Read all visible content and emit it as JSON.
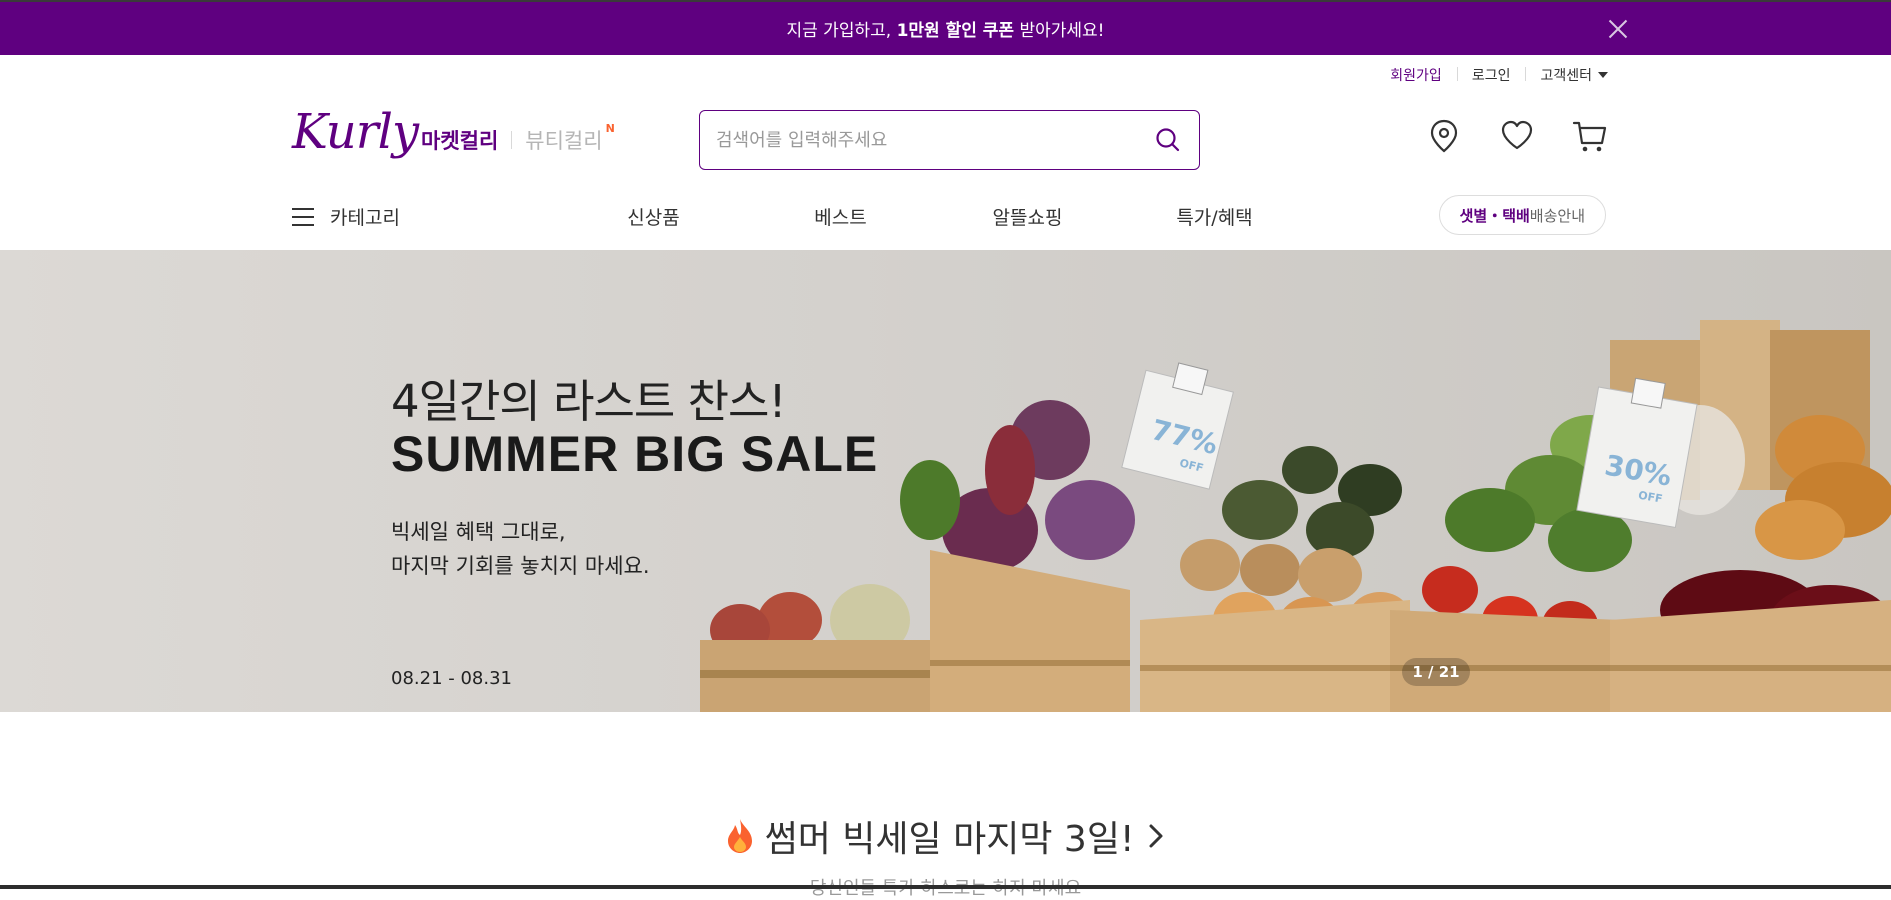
{
  "promo": {
    "text_before": "지금 가입하고, ",
    "text_bold": "1만원 할인 쿠폰",
    "text_after": " 받아가세요!"
  },
  "user_menu": {
    "signup": "회원가입",
    "login": "로그인",
    "customer_center": "고객센터"
  },
  "header": {
    "logo": "Kurly",
    "market_tab": "마켓컬리",
    "beauty_tab": "뷰티컬리",
    "new_badge": "N",
    "search_placeholder": "검색어를 입력해주세요"
  },
  "nav": {
    "category": "카테고리",
    "items": [
      "신상품",
      "베스트",
      "알뜰쇼핑",
      "특가/혜택"
    ],
    "delivery_highlight": "샛별・택배",
    "delivery_rest": " 배송안내"
  },
  "hero": {
    "headline": "4일간의 라스트 찬스!",
    "title": "SUMMER BIG SALE",
    "desc": "빅세일 혜택 그대로,\n마지막 기회를 놓치지 마세요.",
    "period": "08.21 - 08.31",
    "tag1": "77%",
    "tag2": "30%",
    "tag_off": "OFF",
    "counter": "1 / 21"
  },
  "section": {
    "title": "썸머 빅세일 마지막 3일!",
    "subtitle": "당신인들 특가 하스로는 하지 마세요"
  },
  "colors": {
    "brand": "#5f0080",
    "accent": "#fa622f"
  }
}
